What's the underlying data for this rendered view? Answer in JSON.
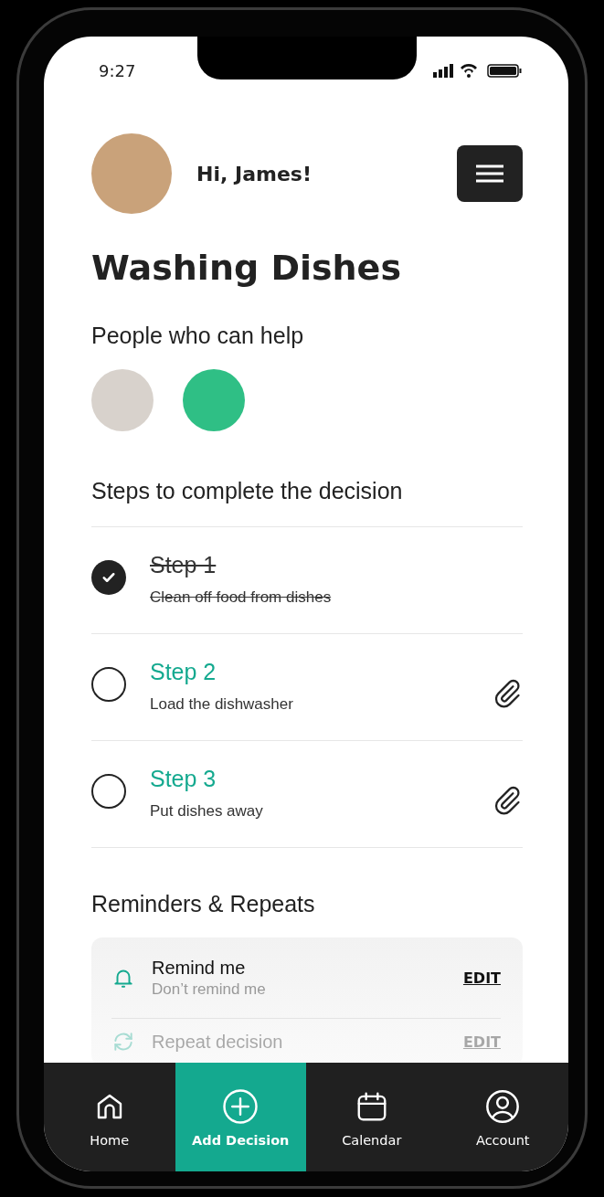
{
  "status_bar": {
    "time": "9:27"
  },
  "header": {
    "greeting": "Hi, James!"
  },
  "title": "Washing Dishes",
  "helpers": {
    "heading": "People who can help",
    "avatars": [
      {
        "color": "#d8d2cc"
      },
      {
        "color": "#2fbf85"
      }
    ]
  },
  "steps": {
    "heading": "Steps to complete the decision",
    "items": [
      {
        "title": "Step 1",
        "description": "Clean off food from dishes",
        "checked": true,
        "attachment": false
      },
      {
        "title": "Step 2",
        "description": "Load the dishwasher",
        "checked": false,
        "attachment": true
      },
      {
        "title": "Step 3",
        "description": "Put dishes away",
        "checked": false,
        "attachment": true
      }
    ]
  },
  "reminders": {
    "heading": "Reminders & Repeats",
    "items": [
      {
        "kind": "remind",
        "title": "Remind me",
        "value": "Don’t remind me",
        "action": "EDIT",
        "faded": false
      },
      {
        "kind": "repeat",
        "title": "Repeat decision",
        "action": "EDIT",
        "faded": true
      }
    ]
  },
  "nav": {
    "items": [
      {
        "label": "Home",
        "selected": false
      },
      {
        "label": "Add Decision",
        "selected": true
      },
      {
        "label": "Calendar",
        "selected": false
      },
      {
        "label": "Account",
        "selected": false
      }
    ]
  }
}
